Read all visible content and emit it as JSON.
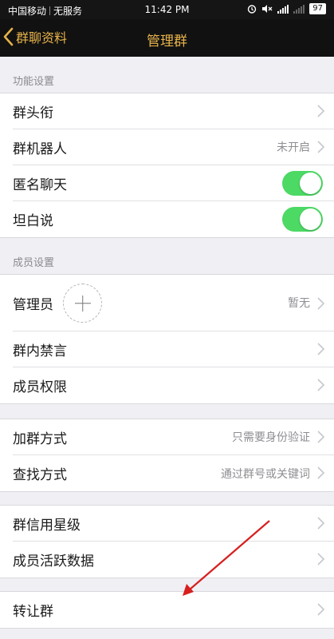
{
  "status_bar": {
    "carrier": "中国移动",
    "service": "无服务",
    "time": "11:42 PM",
    "battery": "97"
  },
  "nav": {
    "back_label": "群聊资料",
    "title": "管理群"
  },
  "sections": {
    "features_header": "功能设置",
    "members_header": "成员设置"
  },
  "rows": {
    "group_title": {
      "label": "群头衔"
    },
    "group_robot": {
      "label": "群机器人",
      "value": "未开启"
    },
    "anonymous_chat": {
      "label": "匿名聊天",
      "toggle": "on"
    },
    "frank_talk": {
      "label": "坦白说",
      "toggle": "on"
    },
    "admins": {
      "label": "管理员",
      "value": "暂无"
    },
    "mute": {
      "label": "群内禁言"
    },
    "permissions": {
      "label": "成员权限"
    },
    "join_method": {
      "label": "加群方式",
      "value": "只需要身份验证"
    },
    "search_method": {
      "label": "查找方式",
      "value": "通过群号或关键词"
    },
    "credit_level": {
      "label": "群信用星级"
    },
    "activity_data": {
      "label": "成员活跃数据"
    },
    "transfer": {
      "label": "转让群"
    }
  },
  "colors": {
    "accent": "#e6b24a",
    "toggle_on": "#4cd964",
    "annotation_arrow": "#d62020"
  }
}
